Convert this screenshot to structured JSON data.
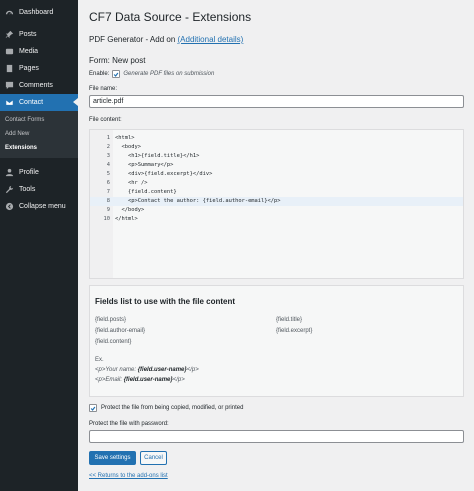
{
  "sidebar": {
    "items": [
      {
        "label": "Dashboard",
        "icon": "dashboard-icon"
      },
      {
        "label": "Posts",
        "icon": "pin-icon"
      },
      {
        "label": "Media",
        "icon": "media-icon"
      },
      {
        "label": "Pages",
        "icon": "page-icon"
      },
      {
        "label": "Comments",
        "icon": "comment-icon"
      },
      {
        "label": "Contact",
        "icon": "envelope-icon"
      },
      {
        "label": "Profile",
        "icon": "user-icon"
      },
      {
        "label": "Tools",
        "icon": "wrench-icon"
      },
      {
        "label": "Collapse menu",
        "icon": "collapse-icon"
      }
    ],
    "submenu": [
      "Contact Forms",
      "Add New",
      "Extensions"
    ]
  },
  "page": {
    "title": "CF7 Data Source - Extensions",
    "addon_prefix": "PDF Generator - Add on",
    "addon_link": "(Additional details)",
    "form_title": "Form: New post",
    "enable_label": "Enable:",
    "enable_hint": "Generate PDF files on submission",
    "file_name_label": "File name:",
    "file_name_value": "article.pdf",
    "file_content_label": "File content:"
  },
  "code": [
    "<html>",
    "  <body>",
    "    <h1>{field.title}</h1>",
    "    <p>Summary</p>",
    "    <div>{field.excerpt}</div>",
    "    <hr />",
    "    {field.content}",
    "    <p>Contact the author: {field.author-email}</p>",
    "  </body>",
    "</html>"
  ],
  "fields_box": {
    "title": "Fields list to use with the file content",
    "tags_left": [
      "{field.posts}",
      "{field.author-email}",
      "{field.content}"
    ],
    "tags_right": [
      "{field.title}",
      "{field.excerpt}"
    ],
    "ex_label": "Ex.",
    "ex1_pre": "<p>Your name: ",
    "ex1_field": "{field.user-name}",
    "ex1_post": "</p>",
    "ex2_pre": "<p>Email: ",
    "ex2_field": "{field.user-name}",
    "ex2_post": "</p>"
  },
  "protect": {
    "checkbox_label": "Protect the file from being copied, modified, or printed",
    "password_label": "Protect the file with password:",
    "password_value": ""
  },
  "buttons": {
    "save": "Save settings",
    "cancel": "Cancel",
    "back": "<< Returns to the add-ons list"
  },
  "colors": {
    "accent": "#2271b1",
    "sidebar_bg": "#1d2327",
    "page_bg": "#f0f0f1"
  }
}
